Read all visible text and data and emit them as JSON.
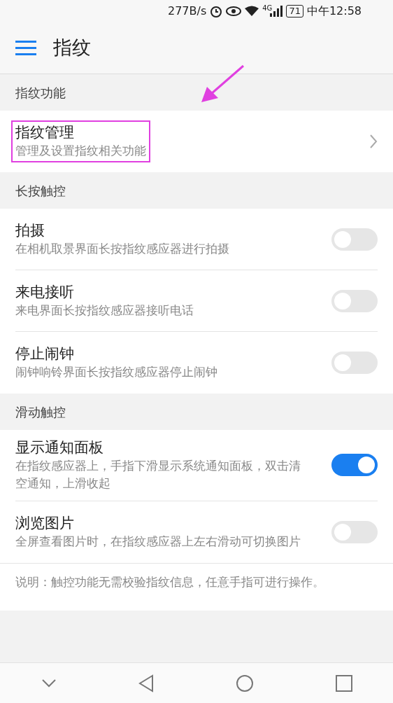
{
  "status_bar": {
    "speed": "277B/s",
    "network": "4G",
    "battery": "71",
    "time": "中午12:58"
  },
  "header": {
    "title": "指纹"
  },
  "sections": [
    {
      "title": "指纹功能",
      "items": [
        {
          "kind": "link",
          "title": "指纹管理",
          "subtitle": "管理及设置指纹相关功能",
          "highlighted": true
        }
      ]
    },
    {
      "title": "长按触控",
      "items": [
        {
          "kind": "switch",
          "title": "拍摄",
          "subtitle": "在相机取景界面长按指纹感应器进行拍摄",
          "on": false
        },
        {
          "kind": "switch",
          "title": "来电接听",
          "subtitle": "来电界面长按指纹感应器接听电话",
          "on": false
        },
        {
          "kind": "switch",
          "title": "停止闹钟",
          "subtitle": "闹钟响铃界面长按指纹感应器停止闹钟",
          "on": false
        }
      ]
    },
    {
      "title": "滑动触控",
      "items": [
        {
          "kind": "switch",
          "title": "显示通知面板",
          "subtitle": "在指纹感应器上，手指下滑显示系统通知面板，双击清空通知，上滑收起",
          "on": true
        },
        {
          "kind": "switch",
          "title": "浏览图片",
          "subtitle": "全屏查看图片时，在指纹感应器上左右滑动可切换图片",
          "on": false
        }
      ]
    }
  ],
  "note": "说明：触控功能无需校验指纹信息，任意手指可进行操作。"
}
